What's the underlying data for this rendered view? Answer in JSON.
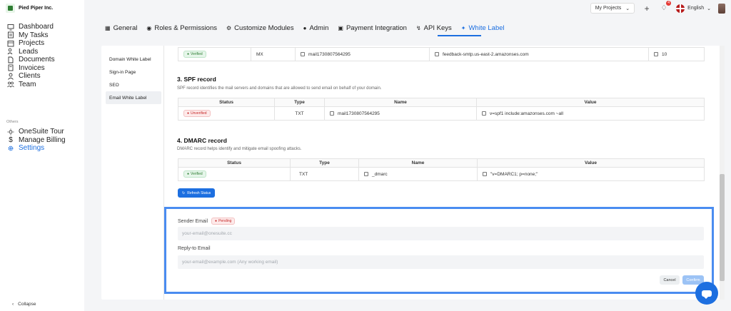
{
  "brand": {
    "name": "Pied Piper Inc."
  },
  "sidebar": {
    "items": [
      {
        "label": "Dashboard",
        "icon": "monitor-icon"
      },
      {
        "label": "My Tasks",
        "icon": "checklist-icon"
      },
      {
        "label": "Projects",
        "icon": "calendar-icon"
      },
      {
        "label": "Leads",
        "icon": "users-icon"
      },
      {
        "label": "Documents",
        "icon": "document-icon"
      },
      {
        "label": "Invoices",
        "icon": "invoice-icon"
      },
      {
        "label": "Clients",
        "icon": "user-icon"
      },
      {
        "label": "Team",
        "icon": "team-icon"
      }
    ],
    "others_label": "Others",
    "others": [
      {
        "label": "OneSuite Tour",
        "icon": "sun-icon"
      },
      {
        "label": "Manage Billing",
        "icon": "dollar-icon"
      },
      {
        "label": "Settings",
        "icon": "gear-icon"
      }
    ],
    "collapse_label": "Collapse"
  },
  "topbar": {
    "project_select": "My Projects",
    "notification_count": "4",
    "language": "English"
  },
  "tabs": [
    {
      "label": "General",
      "icon": "briefcase-icon"
    },
    {
      "label": "Roles & Permissions",
      "icon": "shield-icon"
    },
    {
      "label": "Customize Modules",
      "icon": "gear-icon"
    },
    {
      "label": "Admin",
      "icon": "admin-icon"
    },
    {
      "label": "Payment Integration",
      "icon": "payment-icon"
    },
    {
      "label": "API Keys",
      "icon": "key-icon"
    },
    {
      "label": "White Label",
      "icon": "brush-icon"
    }
  ],
  "subnav": [
    "Domain White Label",
    "Sign-in Page",
    "SEO",
    "Email White Label"
  ],
  "mx_row": {
    "status": "Verified",
    "type": "MX",
    "name": "mail1730807564295",
    "value": "feedback-smtp.us-east-2.amazonses.com",
    "priority": "10"
  },
  "spf": {
    "title": "3. SPF record",
    "desc": "SPF record identifies the mail servers and domains that are allowed to send email on behalf of your domain.",
    "headers": [
      "Status",
      "Type",
      "Name",
      "Value"
    ],
    "row": {
      "status": "Unverified",
      "type": "TXT",
      "name": "mail1730807564295",
      "value": "v=spf1 include:amazonses.com ~all"
    }
  },
  "dmarc": {
    "title": "4. DMARC record",
    "desc": "DMARC record helps identify and mitigate email spoofing attacks.",
    "headers": [
      "Status",
      "Type",
      "Name",
      "Value"
    ],
    "row": {
      "status": "Verified",
      "type": "TXT",
      "name": "_dmarc",
      "value": "\"v=DMARC1; p=none;\""
    }
  },
  "refresh_label": "Refresh Status",
  "form": {
    "sender_label": "Sender Email",
    "sender_status": "Pending",
    "sender_placeholder": "your-email@onesuite.cc",
    "reply_label": "Reply-to Email",
    "reply_placeholder": "your-email@example.com (Any working email)",
    "cancel": "Cancel",
    "confirm": "Confirm"
  },
  "colors": {
    "accent": "#1d6fe0",
    "highlight": "#4a8cf0",
    "verified": "#2e7d32",
    "unverified": "#c62828"
  }
}
